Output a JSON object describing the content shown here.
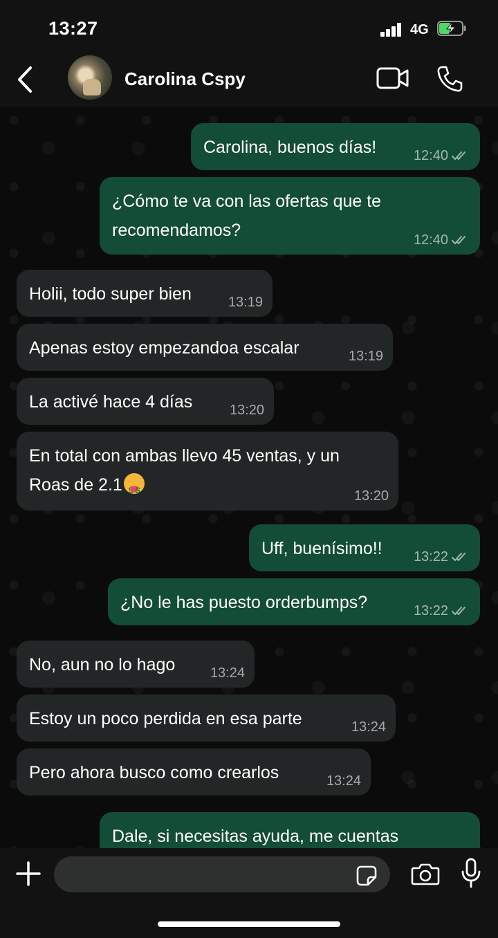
{
  "status_bar": {
    "time": "13:27",
    "network": "4G"
  },
  "header": {
    "contact_name": "Carolina Cspy"
  },
  "messages": [
    {
      "dir": "out",
      "lines": [
        "Carolina, buenos días!"
      ],
      "time": "12:40"
    },
    {
      "dir": "out",
      "lines": [
        "¿Cómo te va con las ofertas que te",
        "recomendamos?"
      ],
      "time": "12:40"
    },
    {
      "dir": "in",
      "lines": [
        "Holii, todo super bien"
      ],
      "time": "13:19"
    },
    {
      "dir": "in",
      "lines": [
        "Apenas estoy empezandoa escalar"
      ],
      "time": "13:19"
    },
    {
      "dir": "in",
      "lines": [
        "La activé hace 4 días"
      ],
      "time": "13:20"
    },
    {
      "dir": "in",
      "lines": [
        "En total con ambas llevo 45 ventas, y un",
        "Roas de 2.1"
      ],
      "emoji": "money-mouth-face",
      "time": "13:20"
    },
    {
      "dir": "out",
      "lines": [
        "Uff, buenísimo!!"
      ],
      "time": "13:22"
    },
    {
      "dir": "out",
      "lines": [
        "¿No le has puesto orderbumps?"
      ],
      "time": "13:22"
    },
    {
      "dir": "in",
      "lines": [
        "No, aun no lo hago"
      ],
      "time": "13:24"
    },
    {
      "dir": "in",
      "lines": [
        "Estoy un poco perdida en esa parte"
      ],
      "time": "13:24"
    },
    {
      "dir": "in",
      "lines": [
        "Pero ahora busco como crearlos"
      ],
      "time": "13:24"
    },
    {
      "dir": "out",
      "lines": [
        "Dale, si necesitas ayuda, me cuentas"
      ],
      "time": ""
    }
  ],
  "input": {
    "placeholder": ""
  },
  "colors": {
    "outgoing_bubble": "#144d37",
    "incoming_bubble": "#232626",
    "battery_charge": "#4cd964"
  },
  "icons": [
    "back-icon",
    "video-call-icon",
    "voice-call-icon",
    "plus-icon",
    "sticker-icon",
    "camera-icon",
    "mic-icon",
    "double-check-icon"
  ]
}
